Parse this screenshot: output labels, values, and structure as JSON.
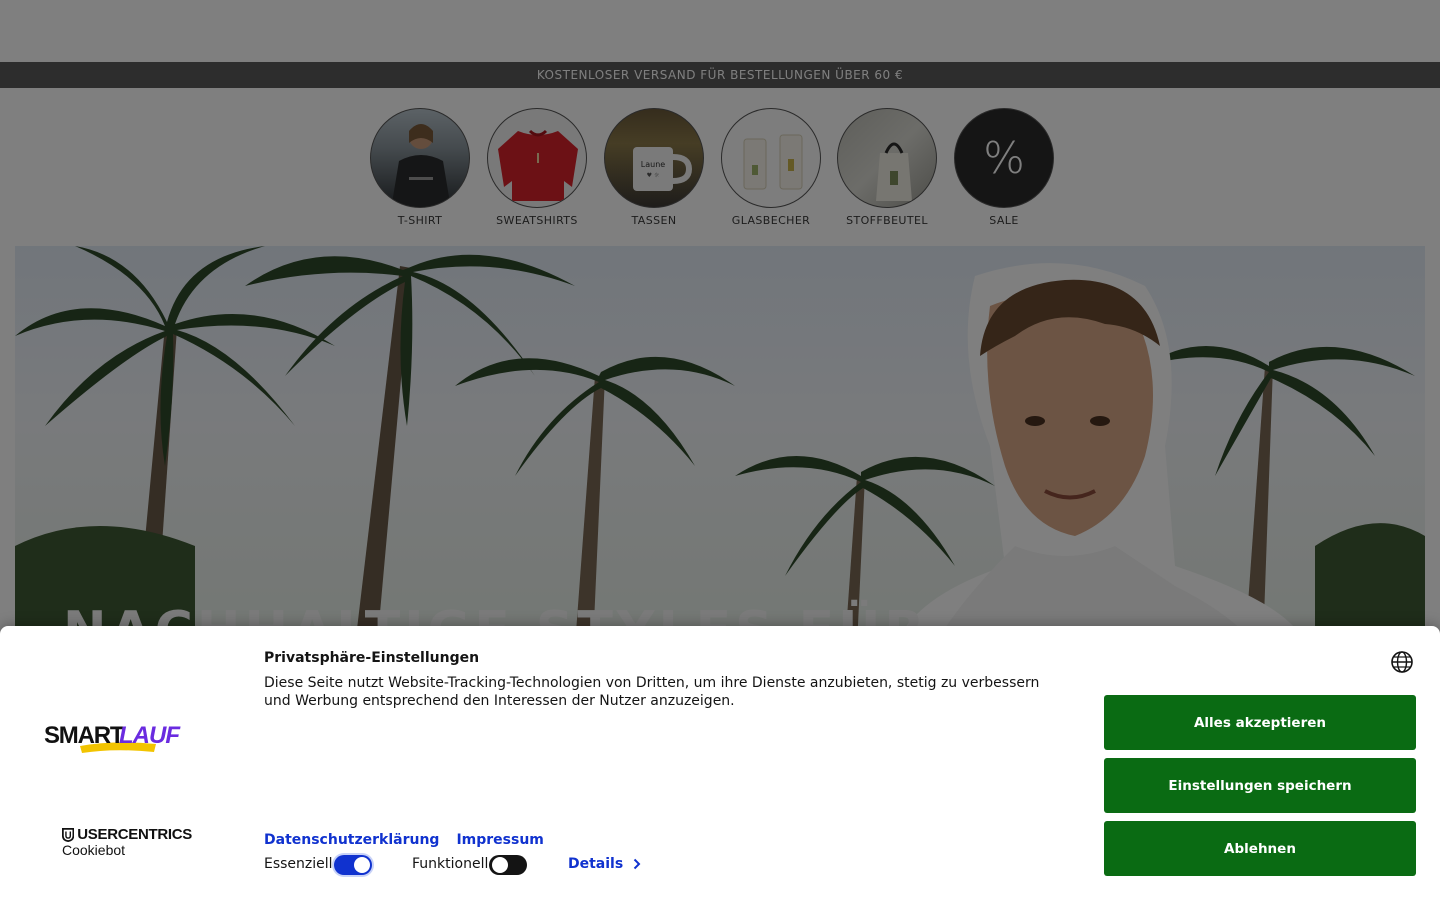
{
  "announcement": "KOSTENLOSER VERSAND FÜR BESTELLUNGEN ÜBER 60 €",
  "categories": [
    {
      "label": "T-SHIRT",
      "icon": "tshirt-model-image"
    },
    {
      "label": "SWEATSHIRTS",
      "icon": "red-sweatshirt-image"
    },
    {
      "label": "TASSEN",
      "icon": "mug-image"
    },
    {
      "label": "GLASBECHER",
      "icon": "glass-cup-image"
    },
    {
      "label": "STOFFBEUTEL",
      "icon": "tote-bag-image"
    },
    {
      "label": "SALE",
      "icon": "percent-icon",
      "symbol": "%"
    }
  ],
  "hero": {
    "headline": "NACHHALTIGE STYLES FÜR"
  },
  "cookie_banner": {
    "title": "Privatsphäre-Einstellungen",
    "text": "Diese Seite nutzt Website-Tracking-Technologien von Dritten, um ihre Dienste anzubieten, stetig zu verbessern und Werbung entsprechend den Interessen der Nutzer anzuzeigen.",
    "brand_logo": "SMARTLAUF",
    "provider_logo": {
      "top": "USERCENTRICS",
      "bottom": "Cookiebot"
    },
    "links": {
      "privacy": "Datenschutzerklärung",
      "imprint": "Impressum"
    },
    "toggles": {
      "essential": {
        "label": "Essenziell",
        "checked": true
      },
      "functional": {
        "label": "Funktionell",
        "checked": false
      }
    },
    "details_label": "Details",
    "buttons": {
      "accept_all": "Alles akzeptieren",
      "save_settings": "Einstellungen speichern",
      "decline": "Ablehnen"
    },
    "language_icon": "globe-icon"
  },
  "colors": {
    "button_green": "#0a6b13",
    "link_blue": "#1032cf",
    "announcement_bg": "#5a5a5a",
    "overlay": "rgba(0,0,0,0.5)"
  }
}
